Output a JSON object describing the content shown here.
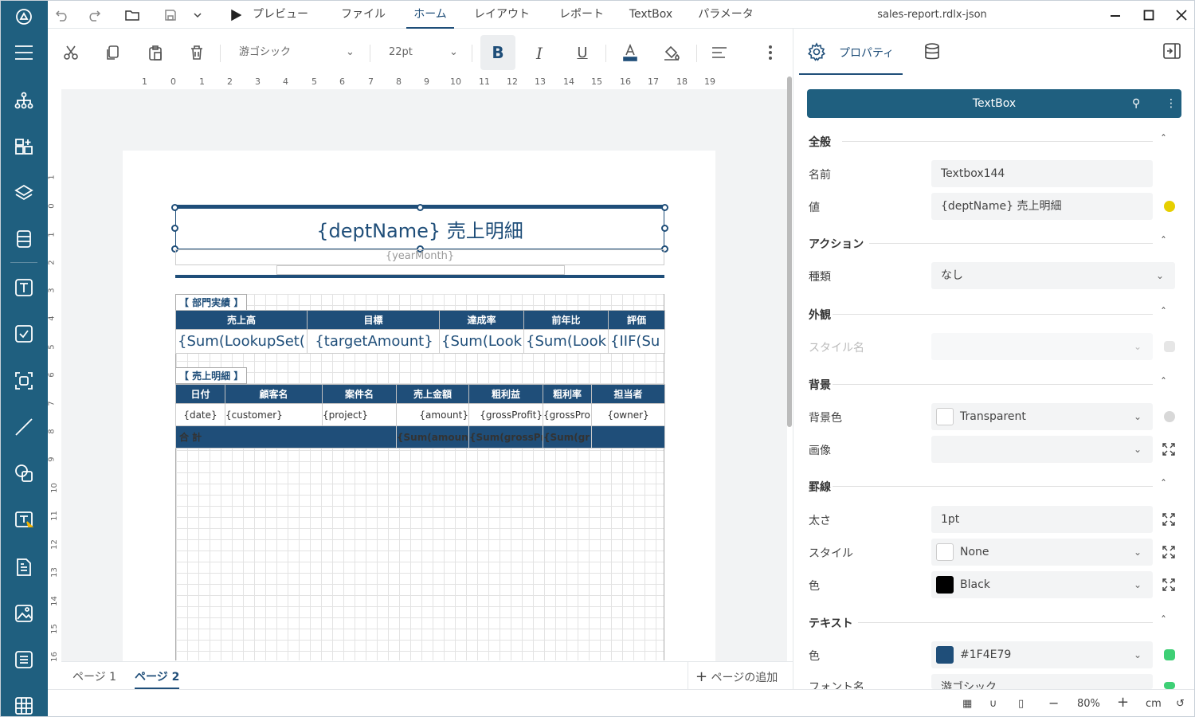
{
  "window": {
    "title": "sales-report.rdlx-json"
  },
  "menu": [
    {
      "label": "プレビュー"
    },
    {
      "label": "ファイル"
    },
    {
      "label": "ホーム"
    },
    {
      "label": "レイアウト"
    },
    {
      "label": "レポート"
    },
    {
      "label": "TextBox"
    },
    {
      "label": "パラメータ"
    }
  ],
  "toolbar": {
    "font": "游ゴシック",
    "size": "22pt",
    "bold": "B",
    "italic": "I",
    "underline": "U"
  },
  "ruler": {
    "h": [
      "1",
      "0",
      "1",
      "2",
      "3",
      "4",
      "5",
      "6",
      "7",
      "8",
      "9",
      "10",
      "11",
      "12",
      "13",
      "14",
      "15",
      "16",
      "17",
      "18",
      "19"
    ],
    "v": [
      "1",
      "0",
      "1",
      "2",
      "3",
      "4",
      "5",
      "6",
      "7",
      "8",
      "9",
      "10",
      "11",
      "12",
      "13",
      "14",
      "15",
      "16"
    ]
  },
  "report": {
    "title": "{deptName} 売上明細",
    "subtitle": "{yearMonth}",
    "section1": "【 部門実績 】",
    "section2": "【 売上明細 】",
    "t1_headers": [
      "売上高",
      "目標",
      "達成率",
      "前年比",
      "評価"
    ],
    "t1_values": [
      "{Sum(LookupSet(",
      "{targetAmount}",
      "{Sum(Look",
      "{Sum(Look",
      "{IIF(Su"
    ],
    "t2_headers": [
      "日付",
      "顧客名",
      "案件名",
      "売上金額",
      "粗利益",
      "粗利率",
      "担当者"
    ],
    "t2_values": [
      "{date}",
      "{customer}",
      "{project}",
      "{amount}",
      "{grossProfit}",
      "{grossPro",
      "{owner}"
    ],
    "t2_total": [
      "合 計",
      "{Sum(amount",
      "{Sum(grossPr",
      "{Sum(gr"
    ]
  },
  "pages": {
    "tab1": "ページ 1",
    "tab2": "ページ 2",
    "add": "ページの追加"
  },
  "panel": {
    "tab_properties": "プロパティ",
    "header": "TextBox",
    "sec_general": "全般",
    "name_label": "名前",
    "name_value": "Textbox144",
    "value_label": "値",
    "value_value": "{deptName} 売上明細",
    "sec_action": "アクション",
    "kind_label": "種類",
    "kind_value": "なし",
    "sec_appearance": "外観",
    "style_name_label": "スタイル名",
    "sec_background": "背景",
    "bgcolor_label": "背景色",
    "bgcolor_value": "Transparent",
    "image_label": "画像",
    "sec_border": "罫線",
    "width_label": "太さ",
    "width_value": "1pt",
    "bstyle_label": "スタイル",
    "bstyle_value": "None",
    "bcolor_label": "色",
    "bcolor_value": "Black",
    "sec_text": "テキスト",
    "tcolor_label": "色",
    "tcolor_value": "#1F4E79",
    "font_label": "フォント名",
    "font_value": "游ゴシック"
  },
  "status": {
    "zoom": "80%",
    "unit": "cm"
  },
  "colors": {
    "accent": "#1f4e79",
    "sidebar": "#1f5f7f",
    "value_dot": "#e6cf00",
    "green_dot": "#3ecf75"
  }
}
